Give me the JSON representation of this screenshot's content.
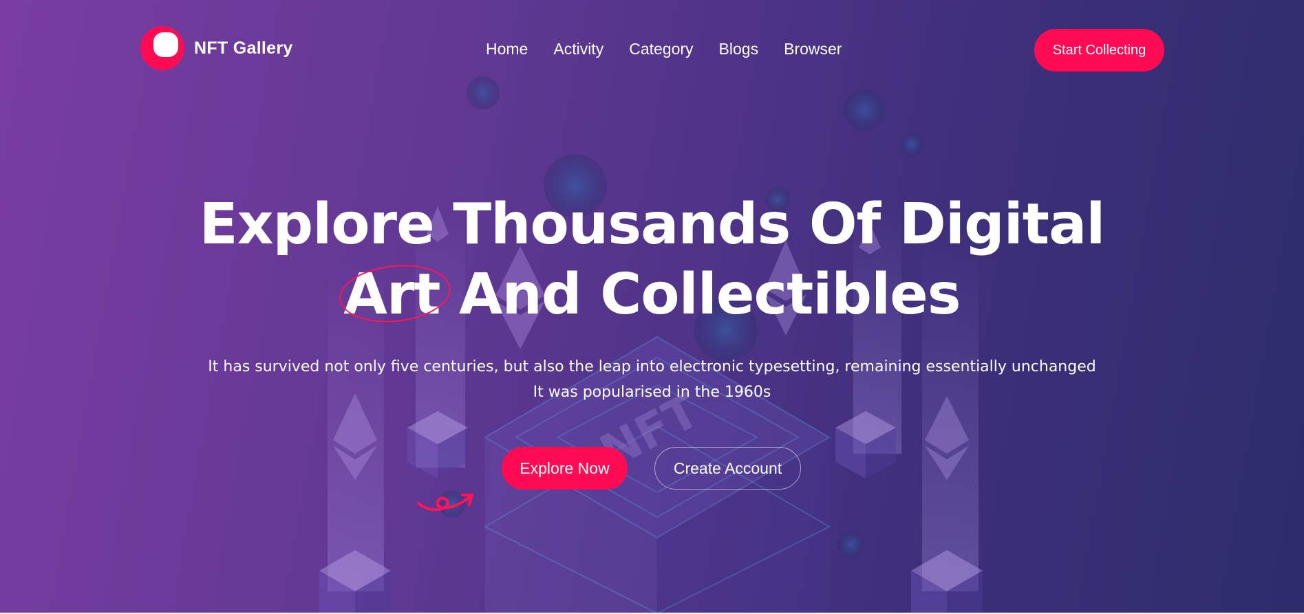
{
  "header": {
    "brand": "NFT Gallery",
    "nav": [
      "Home",
      "Activity",
      "Category",
      "Blogs",
      "Browser"
    ],
    "cta": "Start Collecting"
  },
  "hero": {
    "headline_line1": "Explore Thousands Of Digital",
    "headline_art": "Art",
    "headline_rest": " And Collectibles",
    "subtext_line1": "It has survived not only five centuries, but also the leap into electronic typesetting, remaining essentially unchanged",
    "subtext_line2": "It was popularised in the 1960s",
    "chip_label": "NFT",
    "buttons": {
      "explore": "Explore Now",
      "create": "Create Account"
    }
  },
  "colors": {
    "accent": "#ff0b54",
    "bg_left": "#7a3da2",
    "bg_right": "#2d2d6b",
    "text": "#ffffff"
  },
  "icons": [
    "logo-mark-icon",
    "swirl-arrow-icon"
  ]
}
